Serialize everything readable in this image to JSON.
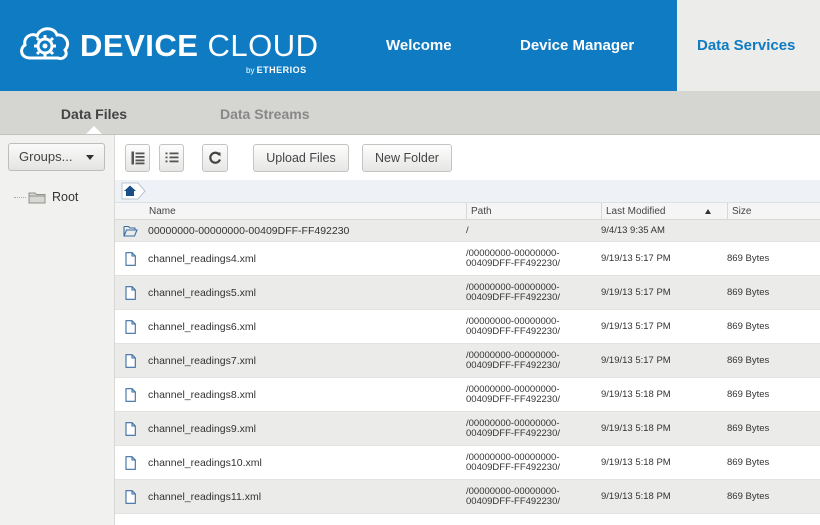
{
  "header": {
    "brand_bold": "DEVICE",
    "brand_light": " CLOUD",
    "brand_sub_prefix": "by ",
    "brand_sub_name": "ETHERIOS",
    "nav": [
      "Welcome",
      "Device Manager",
      "Data Services"
    ],
    "active_nav": "Data Services",
    "colors": {
      "header_bg": "#0f7bc3",
      "active_tab_bg": "#ececea"
    }
  },
  "subtabs": {
    "active": "Data Files",
    "other": "Data Streams"
  },
  "sidebar": {
    "groups_label": "Groups...",
    "root_label": "Root"
  },
  "toolbar": {
    "upload_label": "Upload Files",
    "newfolder_label": "New Folder",
    "icons": [
      "detail-view-icon",
      "list-view-icon",
      "refresh-icon"
    ]
  },
  "breadcrumb": {
    "icon": "home-icon"
  },
  "table": {
    "columns": [
      "Name",
      "Path",
      "Last Modified",
      "Size"
    ],
    "sort_column": "Last Modified",
    "sort_direction": "ascending",
    "rows": [
      {
        "type": "folder",
        "name": "00000000-00000000-00409DFF-FF492230",
        "path": "/",
        "modified": "9/4/13 9:35 AM",
        "size": ""
      },
      {
        "type": "file",
        "name": "channel_readings4.xml",
        "path": "/00000000-00000000-00409DFF-FF492230/",
        "modified": "9/19/13 5:17 PM",
        "size": "869 Bytes"
      },
      {
        "type": "file",
        "name": "channel_readings5.xml",
        "path": "/00000000-00000000-00409DFF-FF492230/",
        "modified": "9/19/13 5:17 PM",
        "size": "869 Bytes"
      },
      {
        "type": "file",
        "name": "channel_readings6.xml",
        "path": "/00000000-00000000-00409DFF-FF492230/",
        "modified": "9/19/13 5:17 PM",
        "size": "869 Bytes"
      },
      {
        "type": "file",
        "name": "channel_readings7.xml",
        "path": "/00000000-00000000-00409DFF-FF492230/",
        "modified": "9/19/13 5:17 PM",
        "size": "869 Bytes"
      },
      {
        "type": "file",
        "name": "channel_readings8.xml",
        "path": "/00000000-00000000-00409DFF-FF492230/",
        "modified": "9/19/13 5:18 PM",
        "size": "869 Bytes"
      },
      {
        "type": "file",
        "name": "channel_readings9.xml",
        "path": "/00000000-00000000-00409DFF-FF492230/",
        "modified": "9/19/13 5:18 PM",
        "size": "869 Bytes"
      },
      {
        "type": "file",
        "name": "channel_readings10.xml",
        "path": "/00000000-00000000-00409DFF-FF492230/",
        "modified": "9/19/13 5:18 PM",
        "size": "869 Bytes"
      },
      {
        "type": "file",
        "name": "channel_readings11.xml",
        "path": "/00000000-00000000-00409DFF-FF492230/",
        "modified": "9/19/13 5:18 PM",
        "size": "869 Bytes"
      }
    ]
  }
}
